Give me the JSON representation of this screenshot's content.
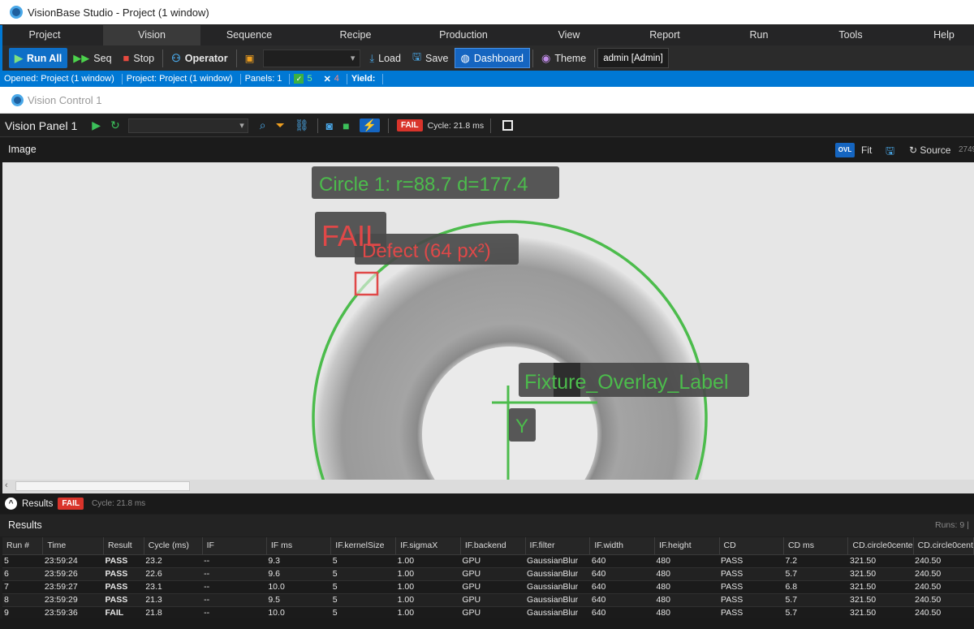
{
  "window": {
    "title": "VisionBase Studio - Project (1 window)"
  },
  "menu": [
    "Project",
    "Vision",
    "Sequence",
    "Recipe",
    "Production",
    "View",
    "Report",
    "Run",
    "Tools",
    "Help"
  ],
  "toolbar": {
    "run_all": "Run All",
    "seq": "Seq",
    "stop": "Stop",
    "operator": "Operator",
    "load": "Load",
    "save": "Save",
    "dashboard": "Dashboard",
    "theme": "Theme",
    "user": "admin  [Admin]"
  },
  "status": {
    "opened": "Opened: Project (1 window)",
    "project": "Project: Project (1 window)",
    "panels": "Panels: 1",
    "pass_count": "5",
    "fail_count": "4",
    "yield_label": "Yield:"
  },
  "vision_control": {
    "title": "Vision Control 1"
  },
  "panel": {
    "title": "Vision Panel 1",
    "fail_badge": "FAIL",
    "cycle": "Cycle: 21.8 ms"
  },
  "image_bar": {
    "label": "Image",
    "ovl": "OVL",
    "fit": "Fit",
    "source": "Source",
    "number": "2749"
  },
  "overlays": {
    "circle_label": "Circle 1: r=88.7 d=177.4",
    "fail_label": "FAIL",
    "defect_label": "Defect (64 px²)",
    "fixture_label": "Fixture_Overlay_Label",
    "y_label": "Y"
  },
  "results": {
    "header_label": "Results",
    "fail_badge": "FAIL",
    "cycle": "Cycle: 21.8 ms",
    "title": "Results",
    "runs": "Runs: 9  |",
    "columns": [
      "Run #",
      "Time",
      "Result",
      "Cycle (ms)",
      "IF",
      "IF ms",
      "IF.kernelSize",
      "IF.sigmaX",
      "IF.backend",
      "IF.filter",
      "IF.width",
      "IF.height",
      "CD",
      "CD ms",
      "CD.circle0cente",
      "CD.circle0cent"
    ],
    "rows": [
      [
        "5",
        "23:59:24",
        "PASS",
        "23.2",
        "--",
        "9.3",
        "5",
        "1.00",
        "GPU",
        "GaussianBlur",
        "640",
        "480",
        "PASS",
        "7.2",
        "321.50",
        "240.50"
      ],
      [
        "6",
        "23:59:26",
        "PASS",
        "22.6",
        "--",
        "9.6",
        "5",
        "1.00",
        "GPU",
        "GaussianBlur",
        "640",
        "480",
        "PASS",
        "5.7",
        "321.50",
        "240.50"
      ],
      [
        "7",
        "23:59:27",
        "PASS",
        "23.1",
        "--",
        "10.0",
        "5",
        "1.00",
        "GPU",
        "GaussianBlur",
        "640",
        "480",
        "PASS",
        "6.8",
        "321.50",
        "240.50"
      ],
      [
        "8",
        "23:59:29",
        "PASS",
        "21.3",
        "--",
        "9.5",
        "5",
        "1.00",
        "GPU",
        "GaussianBlur",
        "640",
        "480",
        "PASS",
        "5.7",
        "321.50",
        "240.50"
      ],
      [
        "9",
        "23:59:36",
        "FAIL",
        "21.8",
        "--",
        "10.0",
        "5",
        "1.00",
        "GPU",
        "GaussianBlur",
        "640",
        "480",
        "PASS",
        "5.7",
        "321.50",
        "240.50"
      ]
    ]
  },
  "colors": {
    "accent": "#0078d4",
    "pass": "#3cc05a",
    "fail": "#e84a3f",
    "overlay_green": "#4cbc4c",
    "overlay_red": "#e04848"
  }
}
